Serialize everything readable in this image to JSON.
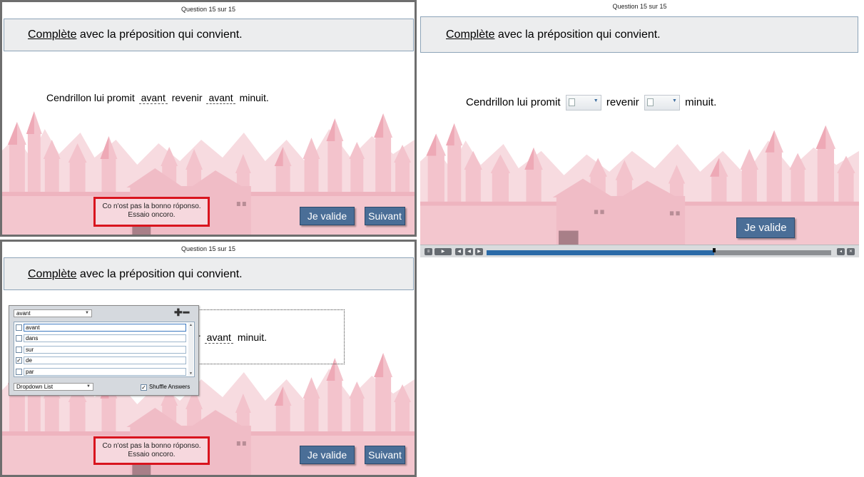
{
  "quiz": {
    "counter": "Question 15 sur 15",
    "instruction_keyword": "Complète",
    "instruction_rest": " avec la préposition qui convient.",
    "sentence_part1": "Cendrillon lui promit ",
    "sentence_part2": " revenir ",
    "sentence_part3": " minuit.",
    "sentence_end": "minuit.",
    "blank1_value": "avant",
    "blank2_value": "avant",
    "validate_label": "Je valide",
    "next_label": "Suivant",
    "feedback_line1": "Co n'ost pas la bonno róponso.",
    "feedback_line2": "Essaio oncoro."
  },
  "editor": {
    "selected_option": "avant",
    "options": [
      {
        "label": "avant",
        "checked": false
      },
      {
        "label": "dans",
        "checked": false
      },
      {
        "label": "sur",
        "checked": false
      },
      {
        "label": "de",
        "checked": true
      },
      {
        "label": "par",
        "checked": false
      }
    ],
    "option_0": "avant",
    "option_1": "dans",
    "option_2": "sur",
    "option_3": "de",
    "option_4": "par",
    "type_label": "Dropdown List",
    "shuffle_label": "Shuffle Answers",
    "shuffle_checked": true
  },
  "playback": {
    "progress": 0.66
  },
  "colors": {
    "button": "#4a6e97",
    "feedback_border": "#d9141e",
    "progress_fill": "#2a6aa7",
    "castle": "#f0b9c3"
  }
}
